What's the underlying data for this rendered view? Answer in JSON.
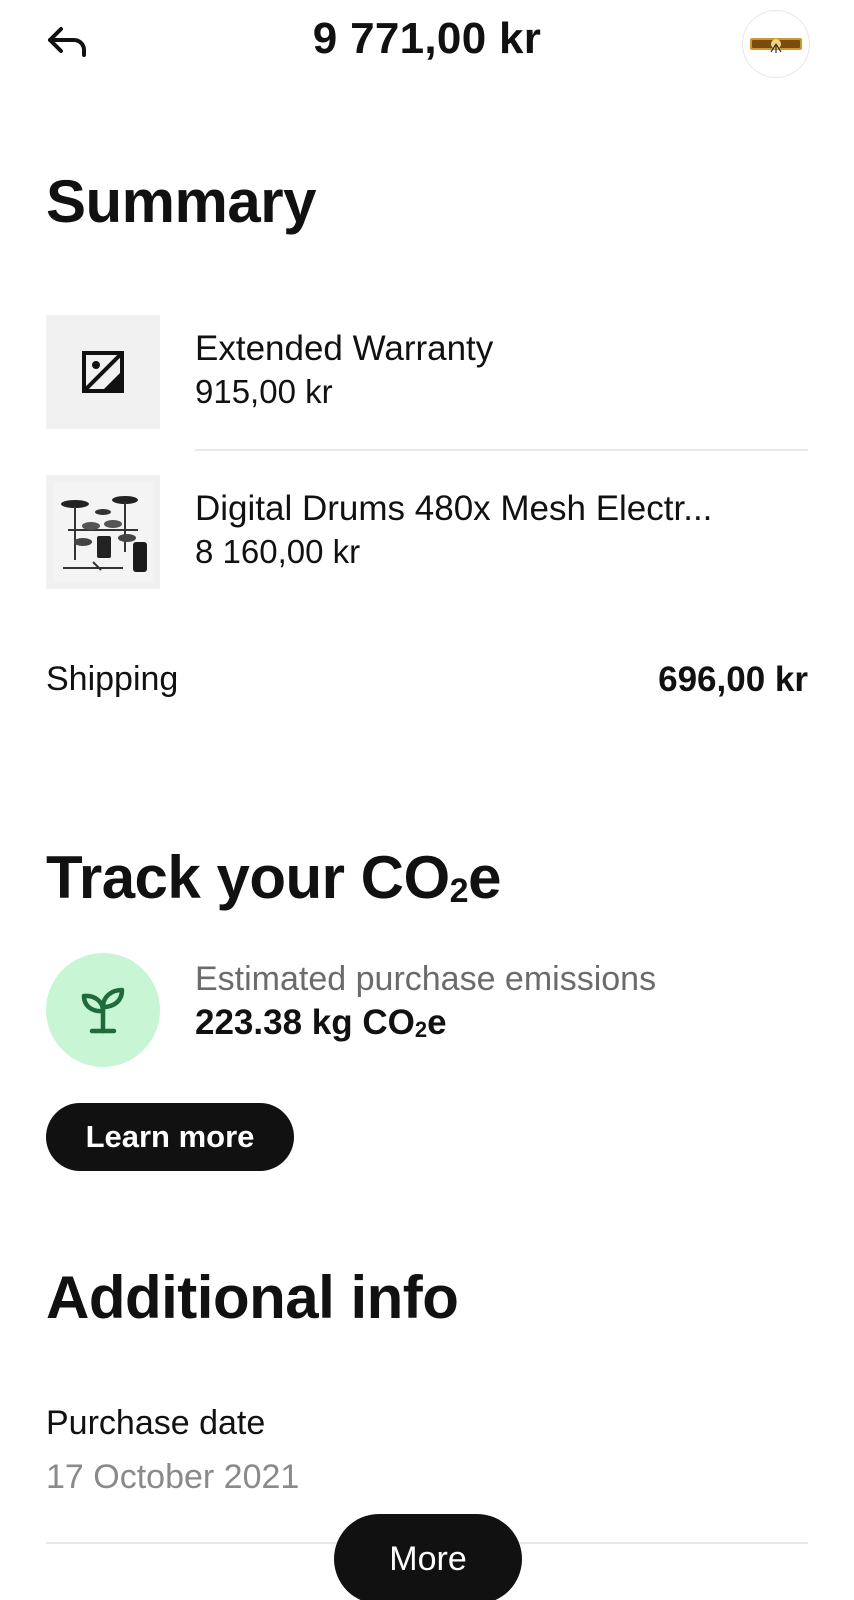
{
  "header": {
    "total": "9 771,00 kr",
    "back_icon": "back-arrow-icon",
    "merchant_logo": "merchant-logo"
  },
  "summary": {
    "title": "Summary",
    "items": [
      {
        "name": "Extended Warranty",
        "price": "915,00 kr",
        "thumbnail": "image-placeholder-icon"
      },
      {
        "name": "Digital Drums 480x Mesh Electr...",
        "price": "8 160,00 kr",
        "thumbnail": "drum-kit-photo"
      }
    ],
    "shipping_label": "Shipping",
    "shipping_value": "696,00 kr"
  },
  "co2": {
    "title_main": "Track your CO",
    "title_sub": "2",
    "title_end": "e",
    "icon": "sprout-icon",
    "label": "Estimated purchase emissions",
    "value_main": "223.38 kg CO",
    "value_sub": "2",
    "value_end": "e",
    "learn_more": "Learn more",
    "accent_color": "#c8f5d4",
    "icon_color": "#1f6b3a"
  },
  "additional": {
    "title": "Additional info",
    "purchase_date_label": "Purchase date",
    "purchase_date_value": "17 October 2021"
  },
  "more_button": "More"
}
